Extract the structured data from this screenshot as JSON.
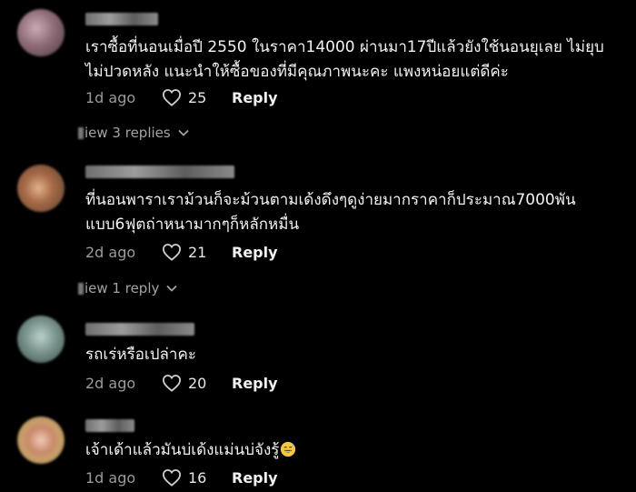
{
  "comments": [
    {
      "text": "เราซื้อที่นอนเมื่อปี 2550 ในราคา14000 ผ่านมา17ปีแล้วยังใช้นอนยุเลย ไม่ยุบ ไม่ปวดหลัง แนะนำให้ซื้อของที่มีคุณภาพนะคะ แพงหน่อยแต่ดีค่ะ",
      "time": "1d ago",
      "likes": "25",
      "reply_label": "Reply",
      "view_replies": "iew 3 replies"
    },
    {
      "text": "ที่นอนพาราเราม้วนก็จะม้วนตามเด้งดึงๆดูง่ายมากราคาก็ประมาณ7000พัน แบบ6ฟุตถ่าหนามากๆก็หลักหมื่น",
      "time": "2d ago",
      "likes": "21",
      "reply_label": "Reply",
      "view_replies": "iew 1 reply"
    },
    {
      "text": "รถเร่หรือเปล่าคะ",
      "time": "2d ago",
      "likes": "20",
      "reply_label": "Reply"
    },
    {
      "text": "เจ้าเด้าแล้วมันบ่เด้งแม่นบ่จังรู้",
      "time": "1d ago",
      "likes": "16",
      "reply_label": "Reply"
    }
  ],
  "icons": {
    "heart": "heart-icon",
    "chevron": "chevron-down-icon",
    "emoji": "sweat-smile-emoji-icon"
  },
  "colors": {
    "background": "#000000",
    "text": "#f2f2f2",
    "muted": "#9a9a9a"
  }
}
